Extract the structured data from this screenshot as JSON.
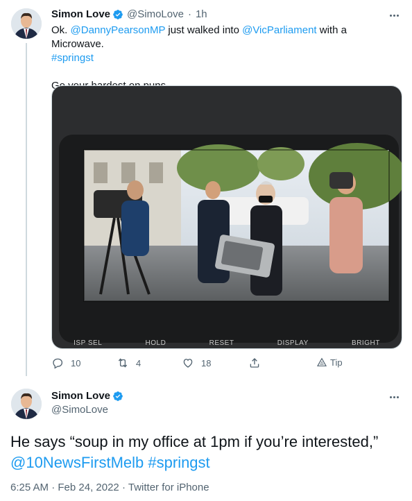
{
  "reply_tweet": {
    "author": {
      "display_name": "Simon Love",
      "handle": "@SimoLove",
      "verified": true
    },
    "time": "1h",
    "text_prefix": "Ok. ",
    "mention_1": "@DannyPearsonMP",
    "text_mid": " just walked into ",
    "mention_2": "@VicParliament",
    "text_after": " with a Microwave.",
    "hashtag": "#springst",
    "text_line2": "Go your hardest on puns.",
    "media": {
      "description_icon": "photo-of-microwave-through-camera-viewfinder",
      "viewfinder_labels": [
        "ISP SEL",
        "HOLD",
        "RESET",
        "DISPLAY",
        "BRIGHT"
      ]
    },
    "actions": {
      "reply_count": "10",
      "retweet_count": "4",
      "like_count": "18",
      "tip_label": "Tip"
    }
  },
  "main_tweet": {
    "author": {
      "display_name": "Simon Love",
      "handle": "@SimoLove",
      "verified": true
    },
    "text": "He says “soup in my office at 1pm if you’re interested,”",
    "mention": "@10NewsFirstMelb",
    "hashtag": "#springst",
    "timestamp": "6:25 AM · Feb 24, 2022",
    "client": "Twitter for iPhone"
  },
  "colors": {
    "link": "#1d9bf0",
    "secondary_text": "#536471",
    "verified": "#1d9bf0"
  }
}
